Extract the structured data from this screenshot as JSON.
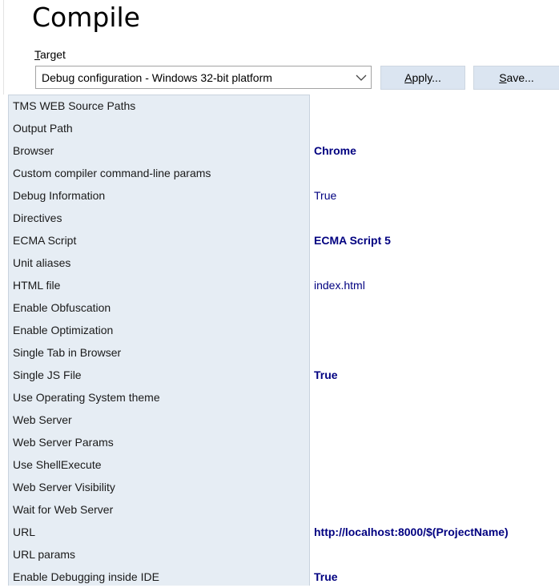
{
  "page": {
    "title": "Compile"
  },
  "target": {
    "label_accel": "T",
    "label_rest": "arget",
    "selected": "Debug configuration - Windows 32-bit platform"
  },
  "buttons": {
    "apply_accel": "A",
    "apply_rest": "pply...",
    "save_accel": "S",
    "save_rest": "ave..."
  },
  "colors": {
    "names_background": "#e6edf4",
    "value_text": "#000080",
    "button_background": "#dbe5f1"
  },
  "properties": [
    {
      "name": "TMS WEB Source Paths",
      "value": "",
      "bold": false
    },
    {
      "name": "Output Path",
      "value": "",
      "bold": false
    },
    {
      "name": "Browser",
      "value": "Chrome",
      "bold": true
    },
    {
      "name": "Custom compiler command-line params",
      "value": "",
      "bold": false
    },
    {
      "name": "Debug Information",
      "value": "True",
      "bold": false
    },
    {
      "name": "Directives",
      "value": "",
      "bold": false
    },
    {
      "name": "ECMA Script",
      "value": "ECMA Script 5",
      "bold": true
    },
    {
      "name": "Unit aliases",
      "value": "",
      "bold": false
    },
    {
      "name": "HTML file",
      "value": "index.html",
      "bold": false
    },
    {
      "name": "Enable Obfuscation",
      "value": "",
      "bold": false
    },
    {
      "name": "Enable Optimization",
      "value": "",
      "bold": false
    },
    {
      "name": "Single Tab in Browser",
      "value": "",
      "bold": false
    },
    {
      "name": "Single JS File",
      "value": "True",
      "bold": true
    },
    {
      "name": "Use Operating System theme",
      "value": "",
      "bold": false
    },
    {
      "name": "Web Server",
      "value": "",
      "bold": false
    },
    {
      "name": "Web Server Params",
      "value": "",
      "bold": false
    },
    {
      "name": "Use ShellExecute",
      "value": "",
      "bold": false
    },
    {
      "name": "Web Server Visibility",
      "value": "",
      "bold": false
    },
    {
      "name": "Wait for Web Server",
      "value": "",
      "bold": false
    },
    {
      "name": "URL",
      "value": "http://localhost:8000/$(ProjectName)",
      "bold": true
    },
    {
      "name": "URL params",
      "value": "",
      "bold": false
    },
    {
      "name": "Enable Debugging inside IDE",
      "value": "True",
      "bold": true
    }
  ]
}
